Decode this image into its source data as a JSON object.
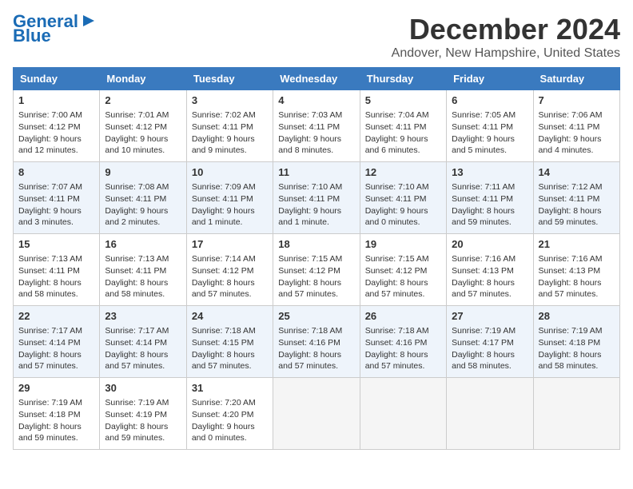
{
  "logo": {
    "line1": "General",
    "line2": "Blue"
  },
  "title": "December 2024",
  "location": "Andover, New Hampshire, United States",
  "weekdays": [
    "Sunday",
    "Monday",
    "Tuesday",
    "Wednesday",
    "Thursday",
    "Friday",
    "Saturday"
  ],
  "weeks": [
    [
      {
        "day": "1",
        "content": "Sunrise: 7:00 AM\nSunset: 4:12 PM\nDaylight: 9 hours\nand 12 minutes."
      },
      {
        "day": "2",
        "content": "Sunrise: 7:01 AM\nSunset: 4:12 PM\nDaylight: 9 hours\nand 10 minutes."
      },
      {
        "day": "3",
        "content": "Sunrise: 7:02 AM\nSunset: 4:11 PM\nDaylight: 9 hours\nand 9 minutes."
      },
      {
        "day": "4",
        "content": "Sunrise: 7:03 AM\nSunset: 4:11 PM\nDaylight: 9 hours\nand 8 minutes."
      },
      {
        "day": "5",
        "content": "Sunrise: 7:04 AM\nSunset: 4:11 PM\nDaylight: 9 hours\nand 6 minutes."
      },
      {
        "day": "6",
        "content": "Sunrise: 7:05 AM\nSunset: 4:11 PM\nDaylight: 9 hours\nand 5 minutes."
      },
      {
        "day": "7",
        "content": "Sunrise: 7:06 AM\nSunset: 4:11 PM\nDaylight: 9 hours\nand 4 minutes."
      }
    ],
    [
      {
        "day": "8",
        "content": "Sunrise: 7:07 AM\nSunset: 4:11 PM\nDaylight: 9 hours\nand 3 minutes."
      },
      {
        "day": "9",
        "content": "Sunrise: 7:08 AM\nSunset: 4:11 PM\nDaylight: 9 hours\nand 2 minutes."
      },
      {
        "day": "10",
        "content": "Sunrise: 7:09 AM\nSunset: 4:11 PM\nDaylight: 9 hours\nand 1 minute."
      },
      {
        "day": "11",
        "content": "Sunrise: 7:10 AM\nSunset: 4:11 PM\nDaylight: 9 hours\nand 1 minute."
      },
      {
        "day": "12",
        "content": "Sunrise: 7:10 AM\nSunset: 4:11 PM\nDaylight: 9 hours\nand 0 minutes."
      },
      {
        "day": "13",
        "content": "Sunrise: 7:11 AM\nSunset: 4:11 PM\nDaylight: 8 hours\nand 59 minutes."
      },
      {
        "day": "14",
        "content": "Sunrise: 7:12 AM\nSunset: 4:11 PM\nDaylight: 8 hours\nand 59 minutes."
      }
    ],
    [
      {
        "day": "15",
        "content": "Sunrise: 7:13 AM\nSunset: 4:11 PM\nDaylight: 8 hours\nand 58 minutes."
      },
      {
        "day": "16",
        "content": "Sunrise: 7:13 AM\nSunset: 4:11 PM\nDaylight: 8 hours\nand 58 minutes."
      },
      {
        "day": "17",
        "content": "Sunrise: 7:14 AM\nSunset: 4:12 PM\nDaylight: 8 hours\nand 57 minutes."
      },
      {
        "day": "18",
        "content": "Sunrise: 7:15 AM\nSunset: 4:12 PM\nDaylight: 8 hours\nand 57 minutes."
      },
      {
        "day": "19",
        "content": "Sunrise: 7:15 AM\nSunset: 4:12 PM\nDaylight: 8 hours\nand 57 minutes."
      },
      {
        "day": "20",
        "content": "Sunrise: 7:16 AM\nSunset: 4:13 PM\nDaylight: 8 hours\nand 57 minutes."
      },
      {
        "day": "21",
        "content": "Sunrise: 7:16 AM\nSunset: 4:13 PM\nDaylight: 8 hours\nand 57 minutes."
      }
    ],
    [
      {
        "day": "22",
        "content": "Sunrise: 7:17 AM\nSunset: 4:14 PM\nDaylight: 8 hours\nand 57 minutes."
      },
      {
        "day": "23",
        "content": "Sunrise: 7:17 AM\nSunset: 4:14 PM\nDaylight: 8 hours\nand 57 minutes."
      },
      {
        "day": "24",
        "content": "Sunrise: 7:18 AM\nSunset: 4:15 PM\nDaylight: 8 hours\nand 57 minutes."
      },
      {
        "day": "25",
        "content": "Sunrise: 7:18 AM\nSunset: 4:16 PM\nDaylight: 8 hours\nand 57 minutes."
      },
      {
        "day": "26",
        "content": "Sunrise: 7:18 AM\nSunset: 4:16 PM\nDaylight: 8 hours\nand 57 minutes."
      },
      {
        "day": "27",
        "content": "Sunrise: 7:19 AM\nSunset: 4:17 PM\nDaylight: 8 hours\nand 58 minutes."
      },
      {
        "day": "28",
        "content": "Sunrise: 7:19 AM\nSunset: 4:18 PM\nDaylight: 8 hours\nand 58 minutes."
      }
    ],
    [
      {
        "day": "29",
        "content": "Sunrise: 7:19 AM\nSunset: 4:18 PM\nDaylight: 8 hours\nand 59 minutes."
      },
      {
        "day": "30",
        "content": "Sunrise: 7:19 AM\nSunset: 4:19 PM\nDaylight: 8 hours\nand 59 minutes."
      },
      {
        "day": "31",
        "content": "Sunrise: 7:20 AM\nSunset: 4:20 PM\nDaylight: 9 hours\nand 0 minutes."
      },
      {
        "day": "",
        "content": ""
      },
      {
        "day": "",
        "content": ""
      },
      {
        "day": "",
        "content": ""
      },
      {
        "day": "",
        "content": ""
      }
    ]
  ]
}
